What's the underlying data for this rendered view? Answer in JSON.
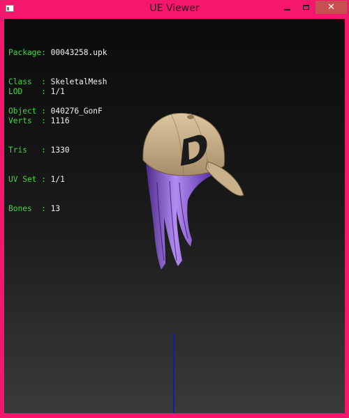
{
  "window": {
    "title": "UE Viewer",
    "controls": {
      "minimize": "minimize",
      "maximize": "maximize",
      "close": "close"
    }
  },
  "info": {
    "object_block": [
      {
        "key": "Package:",
        "value": "00043258.upk"
      },
      {
        "key": "Class  :",
        "value": "SkeletalMesh"
      },
      {
        "key": "Object :",
        "value": "040276_GonF"
      }
    ],
    "stats_block": [
      {
        "key": "LOD    :",
        "value": "1/1"
      },
      {
        "key": "Verts  :",
        "value": "1116"
      },
      {
        "key": "Tris   :",
        "value": "1330"
      },
      {
        "key": "UV Set :",
        "value": "1/1"
      },
      {
        "key": "Bones  :",
        "value": "13"
      }
    ]
  },
  "colors": {
    "title_bar": "#f5166e",
    "label_green": "#3fd83f",
    "value_white": "#f2f2f2",
    "close_button": "#c75050",
    "axis_blue": "#1a16b8",
    "cap_tan": "#c8b08a",
    "hair_purple": "#8a5adf"
  },
  "model": {
    "cap_logo": "D"
  }
}
